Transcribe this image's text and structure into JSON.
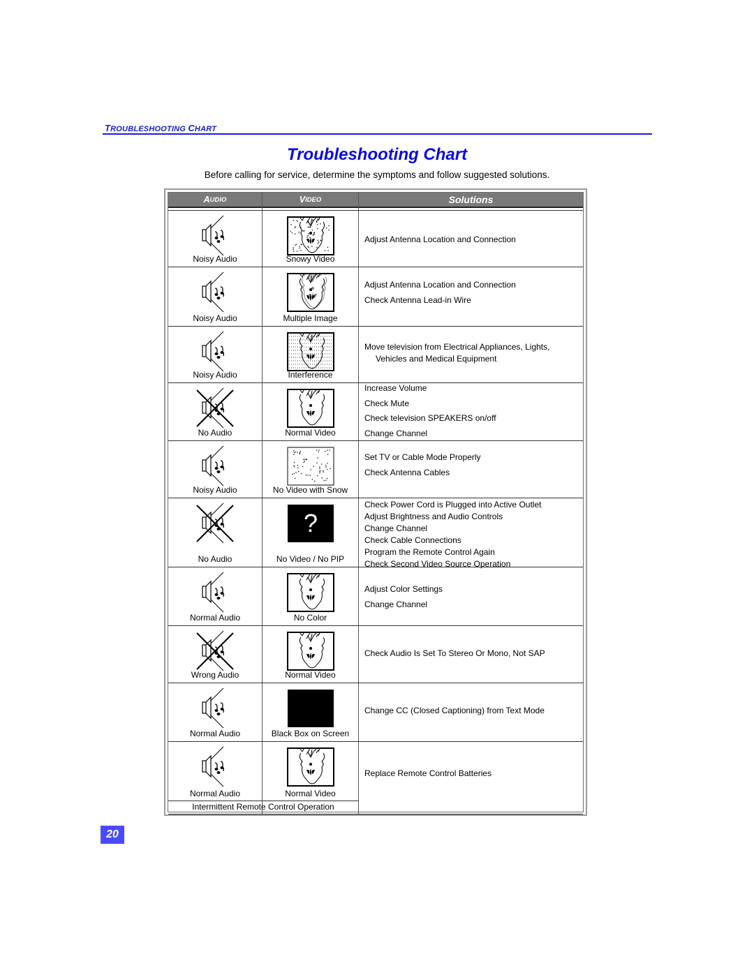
{
  "running_head": {
    "first_big": "T",
    "first_small": "ROUBLESHOOTING ",
    "second_big": "C",
    "second_small": "HART"
  },
  "title": "Troubleshooting Chart",
  "intro": "Before calling for service, determine the symptoms and follow suggested solutions.",
  "headers": {
    "audio_big": "A",
    "audio_small": "UDIO",
    "video_big": "V",
    "video_small": "IDEO",
    "solutions": "Solutions"
  },
  "rows": [
    {
      "audio": "Noisy Audio",
      "audio_icon": "noisy-speaker",
      "video": "Snowy Video",
      "video_icon": "snowy-tv",
      "solutions": [
        "Adjust Antenna Location and Connection"
      ]
    },
    {
      "audio": "Noisy Audio",
      "audio_icon": "noisy-speaker",
      "video": "Multiple Image",
      "video_icon": "ghost-tv",
      "solutions": [
        "Adjust Antenna Location and Connection",
        "Check Antenna Lead-in Wire"
      ]
    },
    {
      "audio": "Noisy Audio",
      "audio_icon": "noisy-speaker",
      "video": "Interference",
      "video_icon": "interference-tv",
      "solutions": [
        "Move television from Electrical Appliances, Lights,",
        "Vehicles and Medical Equipment"
      ]
    },
    {
      "audio": "No Audio",
      "audio_icon": "muted-speaker",
      "video": "Normal Video",
      "video_icon": "normal-tv",
      "solutions": [
        "Increase Volume",
        "Check Mute",
        "Check television SPEAKERS on/off",
        "Change Channel"
      ]
    },
    {
      "audio": "Noisy Audio",
      "audio_icon": "noisy-speaker",
      "video": "No Video with Snow",
      "video_icon": "snow-only-tv",
      "solutions": [
        "Set TV or Cable Mode Properly",
        "Check Antenna Cables"
      ]
    },
    {
      "audio": "No Audio",
      "audio_icon": "muted-speaker",
      "video": "No Video / No PIP",
      "video_icon": "question-tv",
      "video_glyph": "?",
      "solutions": [
        "Check Power Cord is Plugged into Active Outlet",
        "Adjust Brightness and Audio Controls",
        "Change Channel",
        "Check Cable Connections",
        "Program the Remote Control Again",
        "Check Second Video Source Operation"
      ]
    },
    {
      "audio": "Normal Audio",
      "audio_icon": "noisy-speaker",
      "video": "No Color",
      "video_icon": "normal-tv",
      "solutions": [
        "Adjust Color Settings",
        "Change Channel"
      ]
    },
    {
      "audio": "Wrong Audio",
      "audio_icon": "muted-speaker",
      "video": "Normal Video",
      "video_icon": "normal-tv",
      "solutions": [
        "Check Audio Is Set To Stereo Or Mono, Not SAP"
      ]
    },
    {
      "audio": "Normal Audio",
      "audio_icon": "noisy-speaker",
      "video": "Black Box on Screen",
      "video_icon": "black-box-tv",
      "solutions": [
        "Change CC (Closed Captioning) from Text Mode"
      ]
    },
    {
      "audio": "Normal Audio",
      "audio_icon": "noisy-speaker",
      "video": "Normal Video",
      "video_icon": "normal-tv",
      "footer": "Intermittent Remote Control Operation",
      "solutions": [
        "Replace Remote Control Batteries"
      ]
    }
  ],
  "page_number": "20",
  "colors": {
    "accent_blue": "#0a0ae6",
    "header_gray": "#7a7a7a",
    "page_badge": "#4a4aff"
  }
}
